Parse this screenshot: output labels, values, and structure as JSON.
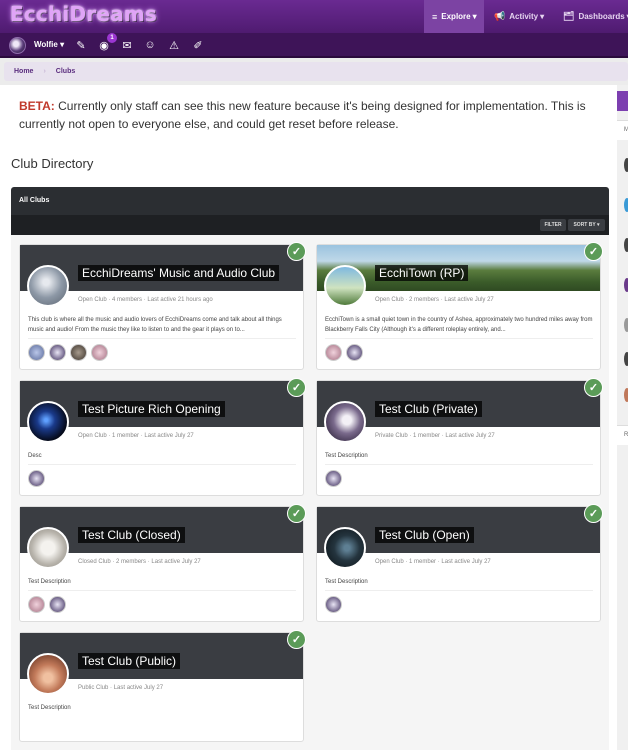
{
  "header": {
    "logo": "EcchiDreams",
    "nav": [
      {
        "icon": "≡",
        "label": "Explore",
        "caret": "▾"
      },
      {
        "icon": "📢",
        "label": "Activity",
        "caret": "▾"
      },
      {
        "icon": "🗂",
        "label": "Dashboards",
        "caret": "▾"
      }
    ]
  },
  "userbar": {
    "username": "Wolfie ▾",
    "notification_count": "1"
  },
  "breadcrumb": [
    "Home",
    "Clubs"
  ],
  "beta": {
    "prefix": "BETA:",
    "text": " Currently only staff can see this new feature because it's being designed for implementation. This is currently not open to everyone else, and could get reset before release."
  },
  "page_title": "Club Directory",
  "directory": {
    "header": "All Clubs",
    "filter_label": "FILTER",
    "sort_label": "SORT BY ▾"
  },
  "clubs": [
    {
      "name": "EcchiDreams' Music and Audio Club",
      "type": "Open Club",
      "members": "4 members",
      "last": "Last active 21 hours ago",
      "desc": "This club is where all the music and audio lovers of EcchiDreams come and talk about all things music and audio! From the music they like to listen to and the gear it plays on to...",
      "member_count": 4,
      "avatar_color": "#9aa8b6"
    },
    {
      "name": "EcchiTown (RP)",
      "type": "Open Club",
      "members": "2 members",
      "last": "Last active July 27",
      "desc": "EcchiTown is a small quiet town in the country of Ashea, approximately two hundred miles away from Blackberry Falls City (Although it's a different roleplay entirely, and...",
      "member_count": 2,
      "avatar_color": "#6aa7d8"
    },
    {
      "name": "Test Picture Rich Opening",
      "type": "Open Club",
      "members": "1 member",
      "last": "Last active July 27",
      "desc": "Desc",
      "member_count": 1,
      "avatar_color": "#0b1a3a"
    },
    {
      "name": "Test Club (Private)",
      "type": "Private Club",
      "members": "1 member",
      "last": "Last active July 27",
      "desc": "Test Description",
      "member_count": 1,
      "avatar_color": "#c9c4d0"
    },
    {
      "name": "Test Club (Closed)",
      "type": "Closed Club",
      "members": "2 members",
      "last": "Last active July 27",
      "desc": "Test Description",
      "member_count": 2,
      "avatar_color": "#d8d6d2"
    },
    {
      "name": "Test Club (Open)",
      "type": "Open Club",
      "members": "1 member",
      "last": "Last active July 27",
      "desc": "Test Description",
      "member_count": 1,
      "avatar_color": "#1c2a34"
    },
    {
      "name": "Test Club (Public)",
      "type": "Public Club",
      "members": "",
      "last": "Last active July 27",
      "desc": "Test Description",
      "member_count": 0,
      "avatar_color": "#c27a5a"
    }
  ],
  "sidebar": {
    "tab": "",
    "letters": [
      "M",
      "R"
    ]
  },
  "colors": {
    "brand": "#5b1f82",
    "accent": "#9b36d1",
    "check": "#5b9b58",
    "beta": "#c0392b"
  }
}
